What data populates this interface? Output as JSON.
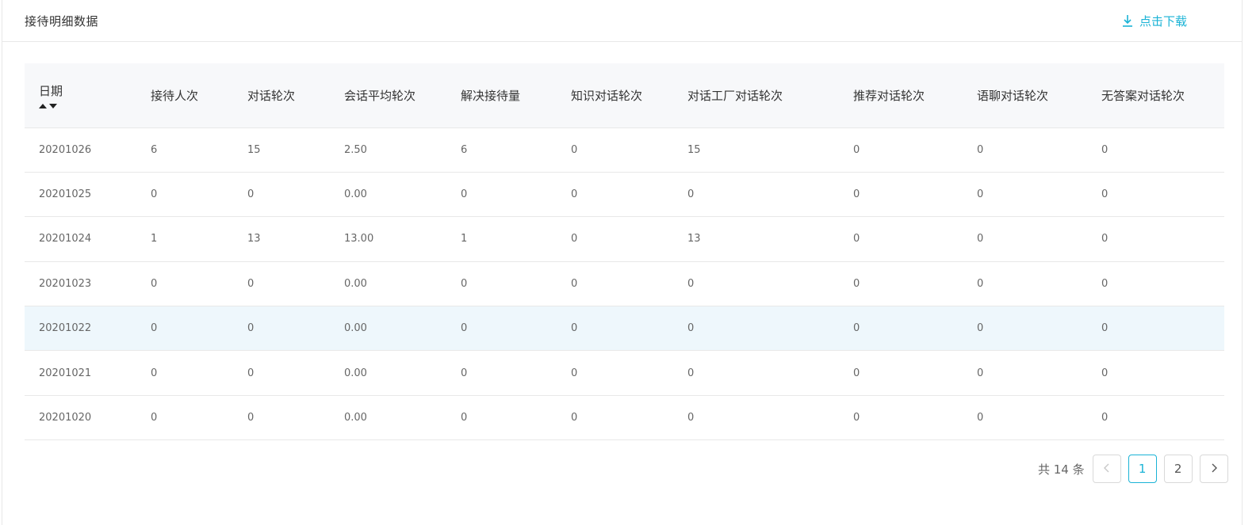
{
  "header": {
    "title": "接待明细数据",
    "download_label": "点击下载"
  },
  "accent_color": "#1ab3d6",
  "table": {
    "columns": [
      "日期",
      "接待人次",
      "对话轮次",
      "会话平均轮次",
      "解决接待量",
      "知识对话轮次",
      "对话工厂对话轮次",
      "推荐对话轮次",
      "语聊对话轮次",
      "无答案对话轮次"
    ],
    "rows": [
      [
        "20201026",
        "6",
        "15",
        "2.50",
        "6",
        "0",
        "15",
        "0",
        "0",
        "0"
      ],
      [
        "20201025",
        "0",
        "0",
        "0.00",
        "0",
        "0",
        "0",
        "0",
        "0",
        "0"
      ],
      [
        "20201024",
        "1",
        "13",
        "13.00",
        "1",
        "0",
        "13",
        "0",
        "0",
        "0"
      ],
      [
        "20201023",
        "0",
        "0",
        "0.00",
        "0",
        "0",
        "0",
        "0",
        "0",
        "0"
      ],
      [
        "20201022",
        "0",
        "0",
        "0.00",
        "0",
        "0",
        "0",
        "0",
        "0",
        "0"
      ],
      [
        "20201021",
        "0",
        "0",
        "0.00",
        "0",
        "0",
        "0",
        "0",
        "0",
        "0"
      ],
      [
        "20201020",
        "0",
        "0",
        "0.00",
        "0",
        "0",
        "0",
        "0",
        "0",
        "0"
      ]
    ]
  },
  "pagination": {
    "total_text": "共 14 条",
    "pages": [
      "1",
      "2"
    ],
    "current_page": "1",
    "prev_icon": "chevron-left-icon",
    "next_icon": "chevron-right-icon"
  }
}
